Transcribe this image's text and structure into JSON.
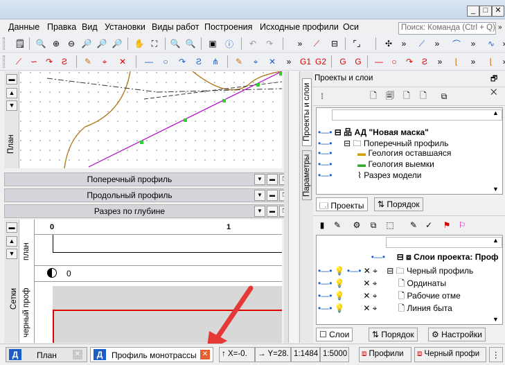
{
  "menu": {
    "items": [
      "Данные",
      "Правка",
      "Вид",
      "Установки",
      "Виды работ",
      "Построения",
      "Исходные профили",
      "Оси"
    ],
    "search_placeholder": "Поиск: Команда (Ctrl + Q)"
  },
  "left_strip": {
    "plan_tab": "План",
    "plan_label": "план",
    "grid_label": "Сетки",
    "profile_label": "черный проф"
  },
  "panels": {
    "cross_profile": "Поперечный профиль",
    "long_profile": "Продольный профиль",
    "depth_section": "Разрез по глубине"
  },
  "profile_view": {
    "ruler_start": "0",
    "ruler_mark": "1",
    "layer_value": "0"
  },
  "right_panel": {
    "top_title": "Проекты и слои",
    "vtab_projects": "Проекты и слои",
    "vtab_params": "Параметры",
    "tree": [
      "АД \"Новая маска\"",
      "Поперечный профиль",
      "Геология оставшаяся",
      "Геология выемки",
      "Разрез модели"
    ],
    "top_tabs": [
      "Проекты",
      "Порядок"
    ],
    "layers_tree": [
      "Слои проекта: Проф",
      "Черный профиль",
      "Ординаты",
      "Рабочие отме",
      "Линия быта"
    ],
    "bottom_tabs": [
      "Слои",
      "Порядок",
      "Настройки"
    ]
  },
  "bottom": {
    "doc_tabs": [
      "План",
      "Профиль монотрассы"
    ],
    "status": {
      "x": "X=-0.",
      "y": "Y=28.",
      "scale1": "1:1484",
      "scale2": "1:5000",
      "profiles": "Профили",
      "black_profile": "Черный профи"
    }
  },
  "colors": {
    "accent_red": "#e53935",
    "alignment": "#b000c8",
    "ground_line": "#b07a1e",
    "profile_red": "#e00000"
  }
}
